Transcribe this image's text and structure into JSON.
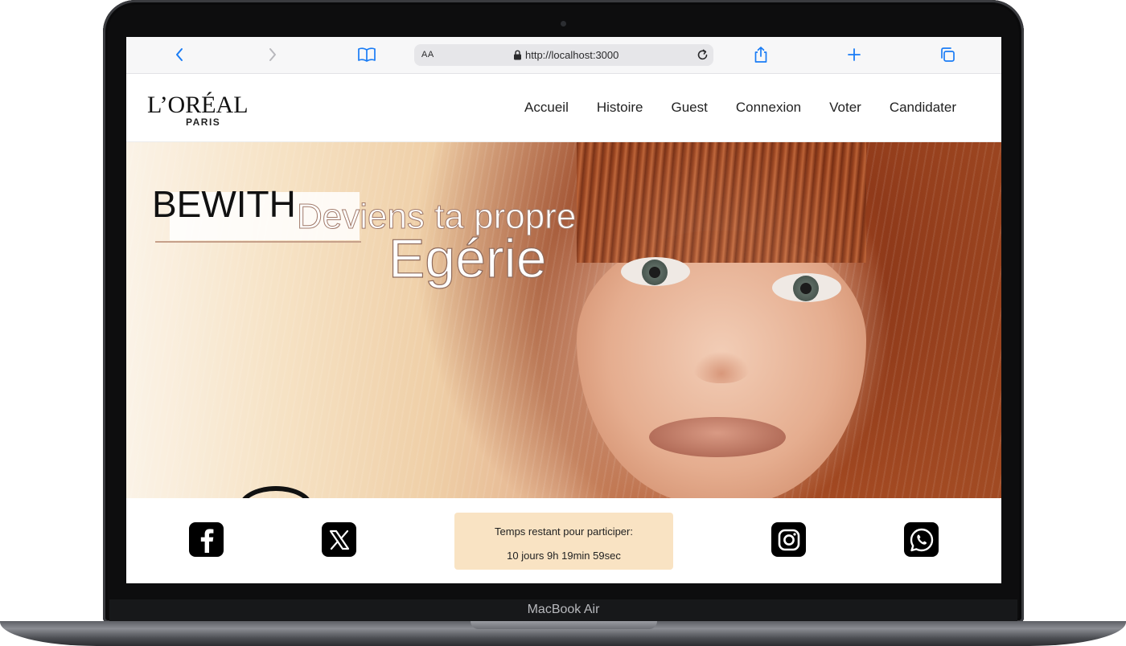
{
  "device": {
    "label": "MacBook Air"
  },
  "browser": {
    "text_size_label": "AA",
    "url": "http://localhost:3000",
    "icons": [
      "back-icon",
      "forward-icon",
      "bookmarks-icon",
      "lock-icon",
      "reload-icon",
      "share-icon",
      "new-tab-icon",
      "tabs-icon"
    ]
  },
  "site": {
    "logo": {
      "main": "L’ORÉAL",
      "sub": "PARIS"
    },
    "nav": [
      "Accueil",
      "Histoire",
      "Guest",
      "Connexion",
      "Voter",
      "Candidater"
    ]
  },
  "hero": {
    "title": "BEWITH",
    "subtitle_line1": "Deviens ta propre",
    "subtitle_line2": "Egérie"
  },
  "footer": {
    "social": [
      "facebook-icon",
      "x-icon",
      "instagram-icon",
      "whatsapp-icon"
    ],
    "countdown": {
      "label": "Temps restant pour participer:",
      "value": "10 jours 9h 19min 59sec",
      "background": "#f9e3c3"
    }
  }
}
